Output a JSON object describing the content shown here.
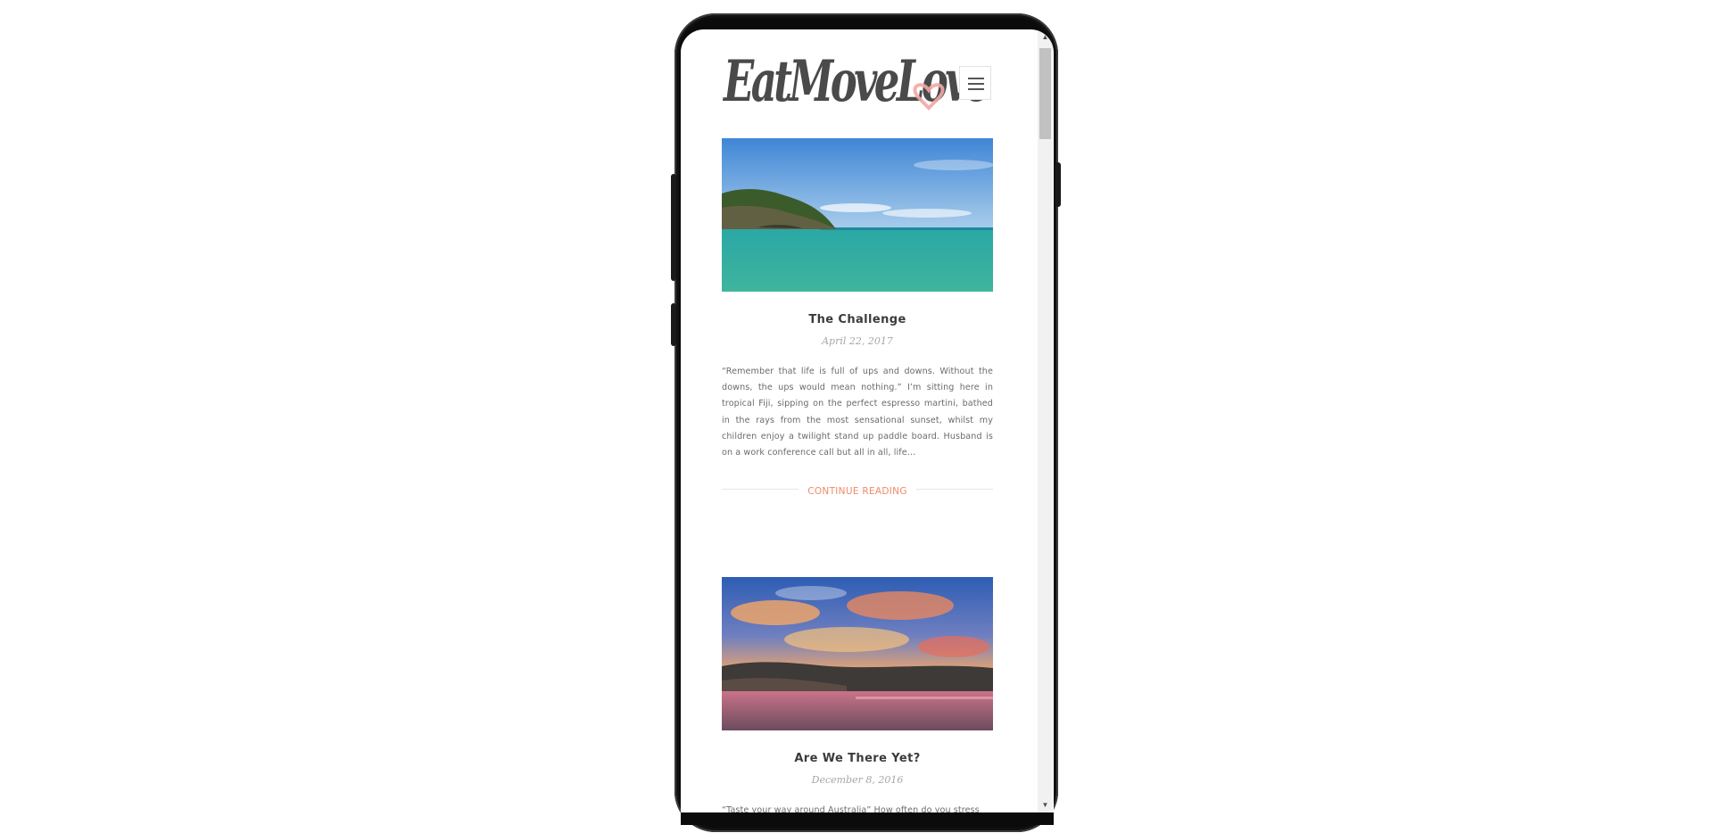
{
  "site": {
    "logo_text": "EatMoveLove",
    "menu_icon": "hamburger-icon"
  },
  "posts": [
    {
      "title": "The Challenge",
      "date": "April 22, 2017",
      "excerpt": "“Remember that life is full of ups and downs. Without the downs, the ups would mean nothing.” I’m sitting here in tropical Fiji, sipping on the perfect espresso martini, bathed in the rays from the most sensational sunset, whilst my children enjoy a twilight stand up paddle board. Husband is on a work conference call but all in all, life…",
      "continue_label": "CONTINUE READING"
    },
    {
      "title": "Are We There Yet?",
      "date": "December 8, 2016",
      "excerpt": "“Taste your way around Australia” How often do you stress"
    }
  ],
  "scrollbar": {
    "up_icon": "scroll-up-arrow-icon",
    "down_icon": "scroll-down-arrow-icon"
  },
  "colors": {
    "accent": "#ee8a6a",
    "title": "#3b3b3b",
    "date": "#a7a7a7",
    "text": "#6b6b6b",
    "logo": "#4a4a4a",
    "heart": "#f1a9a4"
  }
}
